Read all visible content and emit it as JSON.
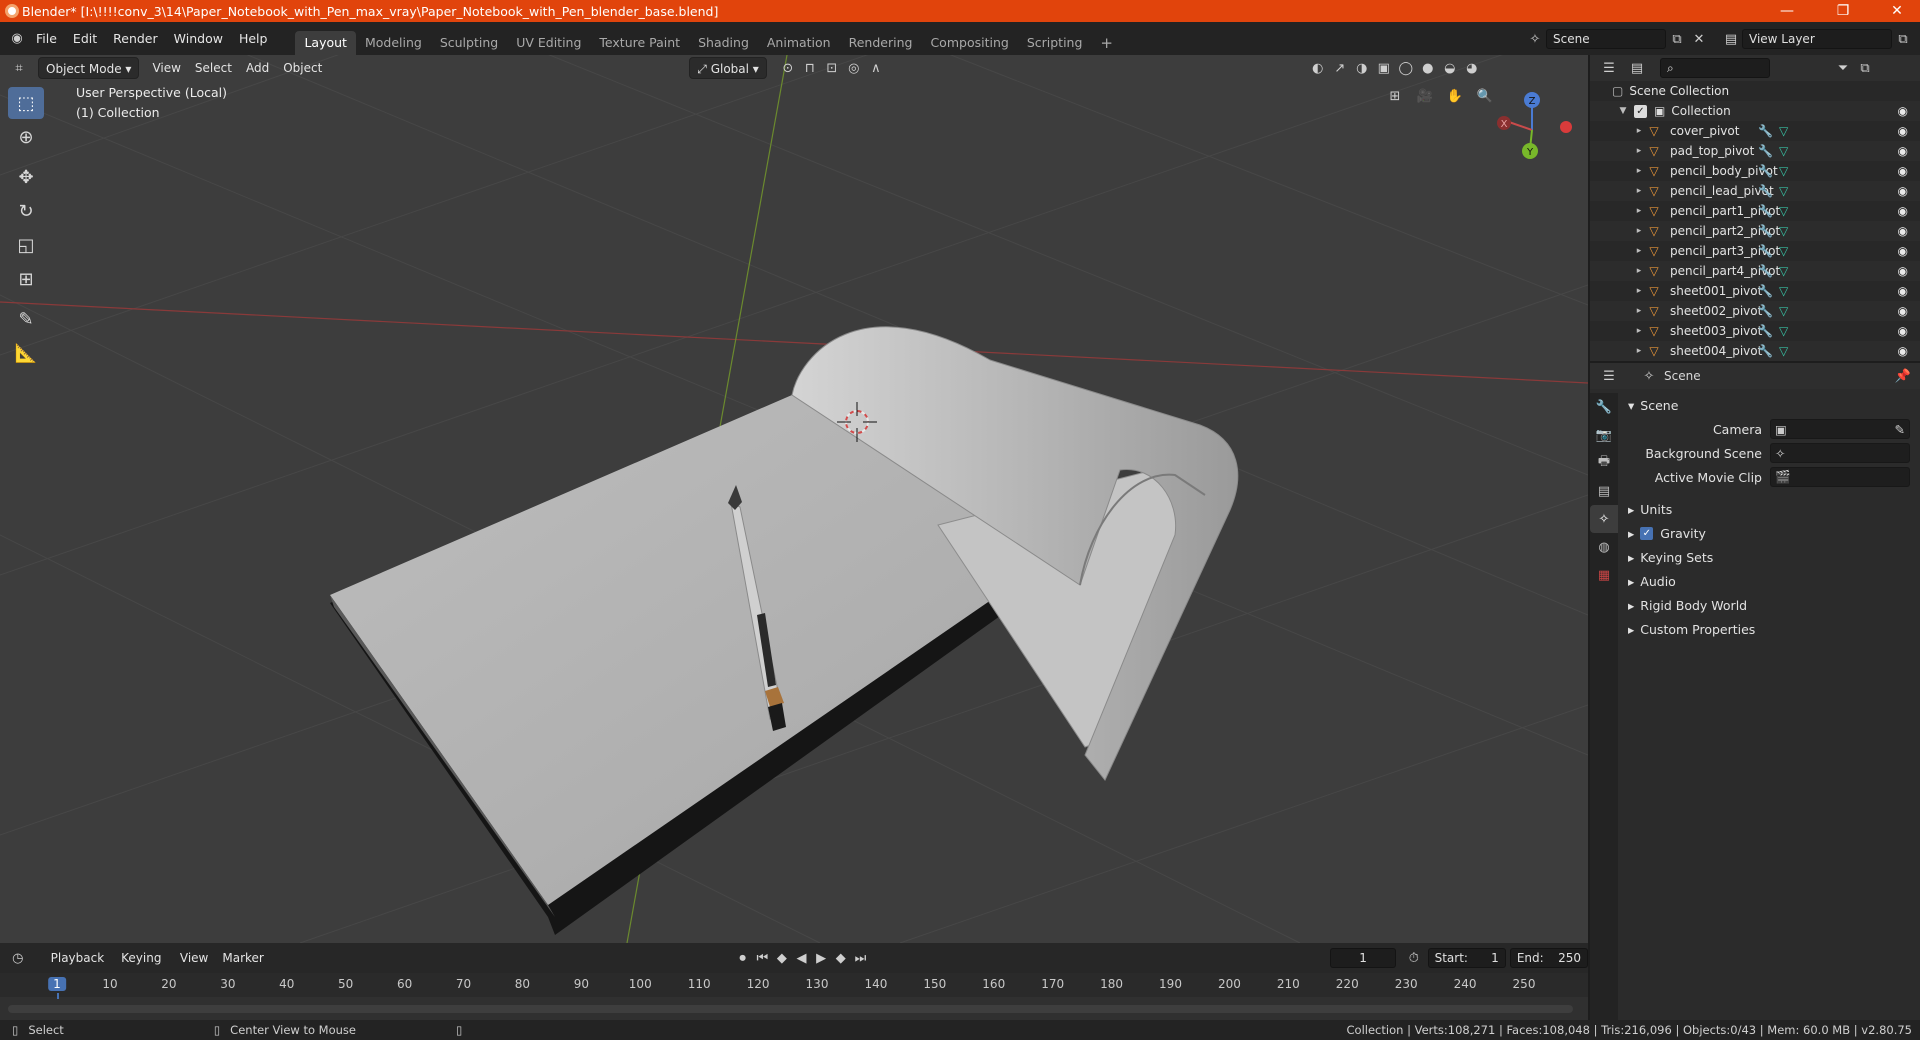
{
  "window": {
    "title": "Blender* [I:\\!!!!conv_3\\14\\Paper_Notebook_with_Pen_max_vray\\Paper_Notebook_with_Pen_blender_base.blend]",
    "minimize": "—",
    "maximize": "❐",
    "close": "✕"
  },
  "menubar": {
    "menus": [
      "File",
      "Edit",
      "Render",
      "Window",
      "Help"
    ],
    "workspaces": [
      "Layout",
      "Modeling",
      "Sculpting",
      "UV Editing",
      "Texture Paint",
      "Shading",
      "Animation",
      "Rendering",
      "Compositing",
      "Scripting"
    ],
    "active_workspace": "Layout",
    "add_workspace": "+",
    "scene": "Scene",
    "view_layer": "View Layer"
  },
  "viewport": {
    "mode": "Object Mode",
    "menus": [
      "View",
      "Select",
      "Add",
      "Object"
    ],
    "orientation": "Global",
    "perspective_label": "User Perspective (Local)",
    "collection_label": "(1) Collection",
    "gizmo_axes": {
      "x": "X",
      "y": "Y",
      "z": "Z"
    }
  },
  "tools": [
    "select-box",
    "cursor",
    "move",
    "rotate",
    "scale",
    "transform",
    "annotate",
    "measure"
  ],
  "timeline": {
    "menus": [
      "Playback",
      "Keying",
      "View",
      "Marker"
    ],
    "current_frame": "1",
    "start_label": "Start:",
    "start": "1",
    "end_label": "End:",
    "end": "250",
    "ticks": [
      "1",
      "10",
      "20",
      "30",
      "40",
      "50",
      "60",
      "70",
      "80",
      "90",
      "100",
      "110",
      "120",
      "130",
      "140",
      "150",
      "160",
      "170",
      "180",
      "190",
      "200",
      "210",
      "220",
      "230",
      "240",
      "250"
    ]
  },
  "status": {
    "select": "Select",
    "center_view": "Center View to Mouse",
    "stats": "Collection | Verts:108,271 | Faces:108,048 | Tris:216,096 | Objects:0/43 | Mem: 60.0 MB | v2.80.75"
  },
  "outliner": {
    "scene_collection": "Scene Collection",
    "collection": "Collection",
    "items": [
      "cover_pivot",
      "pad_top_pivot",
      "pencil_body_pivot",
      "pencil_lead_pivot",
      "pencil_part1_pivot",
      "pencil_part2_pivot",
      "pencil_part3_pivot",
      "pencil_part4_pivot",
      "sheet001_pivot",
      "sheet002_pivot",
      "sheet003_pivot",
      "sheet004_pivot"
    ]
  },
  "properties": {
    "context": "Scene",
    "panel": "Scene",
    "camera_label": "Camera",
    "background_scene_label": "Background Scene",
    "active_movie_clip_label": "Active Movie Clip",
    "subpanels": [
      "Units",
      "Gravity",
      "Keying Sets",
      "Audio",
      "Rigid Body World",
      "Custom Properties"
    ],
    "gravity_enabled": true
  },
  "colors": {
    "titlebar": "#e1440c",
    "accent": "#4772b3",
    "object_icon": "#e9973a"
  }
}
